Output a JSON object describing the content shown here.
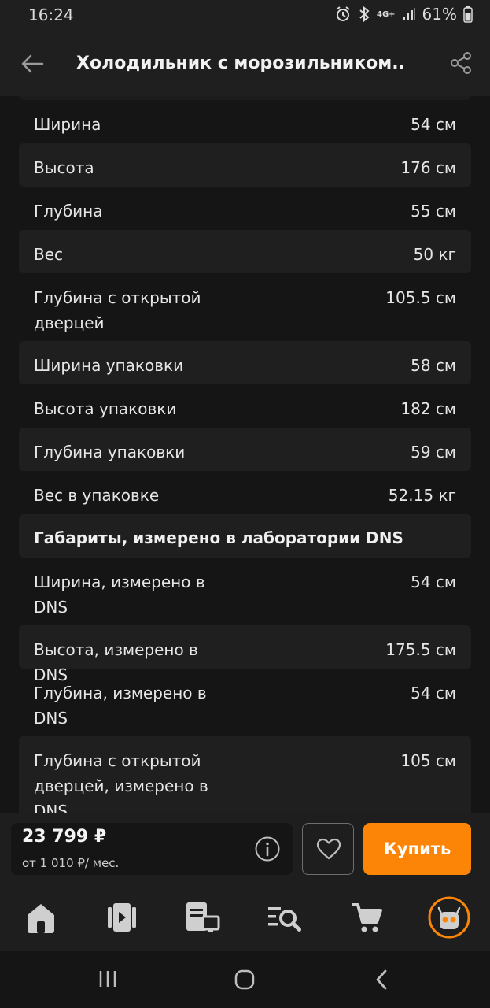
{
  "status_bar": {
    "time": "16:24",
    "network": "4G+",
    "battery": "61%"
  },
  "header": {
    "title": "Холодильник с морозильником..."
  },
  "specs": {
    "rows_before": [
      {
        "label": "Ширина",
        "value": "54 см"
      },
      {
        "label": "Высота",
        "value": "176 см"
      },
      {
        "label": "Глубина",
        "value": "55 см"
      },
      {
        "label": "Вес",
        "value": "50 кг"
      },
      {
        "label": "Глубина с открытой дверцей",
        "value": "105.5 см"
      },
      {
        "label": "Ширина упаковки",
        "value": "58 см"
      },
      {
        "label": "Высота упаковки",
        "value": "182 см"
      },
      {
        "label": "Глубина упаковки",
        "value": "59 см"
      },
      {
        "label": "Вес в упаковке",
        "value": "52.15 кг"
      }
    ],
    "section_title": "Габариты, измерено в лаборатории DNS",
    "rows_after": [
      {
        "label": "Ширина, измерено в DNS",
        "value": "54 см"
      },
      {
        "label": "Высота, измерено в DNS",
        "value": "175.5 см"
      },
      {
        "label": "Глубина, измерено в DNS",
        "value": "54 см"
      },
      {
        "label": "Глубина с открытой дверцей, измерено в DNS",
        "value": "105 см"
      }
    ]
  },
  "buy_bar": {
    "price": "23 799 ₽",
    "credit": "от 1 010 ₽/ мес.",
    "buy_label": "Купить"
  },
  "bottom_nav": {
    "items": [
      "home-icon",
      "catalog-icon",
      "compare-icon",
      "search-list-icon",
      "cart-icon",
      "profile-icon"
    ]
  },
  "colors": {
    "accent": "#fc8507",
    "background": "#151515",
    "row_alt": "#1f1f1f"
  }
}
